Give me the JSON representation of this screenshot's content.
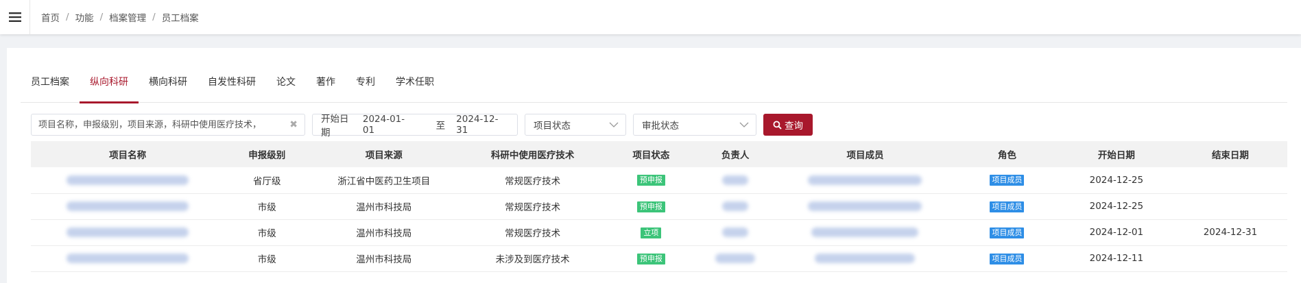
{
  "breadcrumb": [
    "首页",
    "功能",
    "档案管理",
    "员工档案"
  ],
  "tabs": [
    {
      "label": "员工档案",
      "active": false
    },
    {
      "label": "纵向科研",
      "active": true
    },
    {
      "label": "横向科研",
      "active": false
    },
    {
      "label": "自发性科研",
      "active": false
    },
    {
      "label": "论文",
      "active": false
    },
    {
      "label": "著作",
      "active": false
    },
    {
      "label": "专利",
      "active": false
    },
    {
      "label": "学术任职",
      "active": false
    }
  ],
  "filters": {
    "search_placeholder": "项目名称，申报级别，项目来源，科研中使用医疗技术，",
    "date_label": "开始日期",
    "date_start": "2024-01-01",
    "date_to": "至",
    "date_end": "2024-12-31",
    "project_status_placeholder": "项目状态",
    "approval_status_placeholder": "审批状态",
    "query_label": "查询"
  },
  "table": {
    "headers": [
      "项目名称",
      "申报级别",
      "项目来源",
      "科研中使用医疗技术",
      "项目状态",
      "负责人",
      "项目成员",
      "角色",
      "开始日期",
      "结束日期"
    ],
    "rows": [
      {
        "level": "省厅级",
        "source": "浙江省中医药卫生项目",
        "tech": "常规医疗技术",
        "status": "预申报",
        "role": "项目成员",
        "start": "2024-12-25",
        "end": ""
      },
      {
        "level": "市级",
        "source": "温州市科技局",
        "tech": "常规医疗技术",
        "status": "预申报",
        "role": "项目成员",
        "start": "2024-12-25",
        "end": ""
      },
      {
        "level": "市级",
        "source": "温州市科技局",
        "tech": "常规医疗技术",
        "status": "立项",
        "role": "项目成员",
        "start": "2024-12-01",
        "end": "2024-12-31"
      },
      {
        "level": "市级",
        "source": "温州市科技局",
        "tech": "未涉及到医疗技术",
        "status": "预申报",
        "role": "项目成员",
        "start": "2024-12-11",
        "end": ""
      }
    ]
  },
  "colors": {
    "accent": "#a8182c",
    "status_green": "#3cc479",
    "role_blue": "#2e8ee6"
  }
}
